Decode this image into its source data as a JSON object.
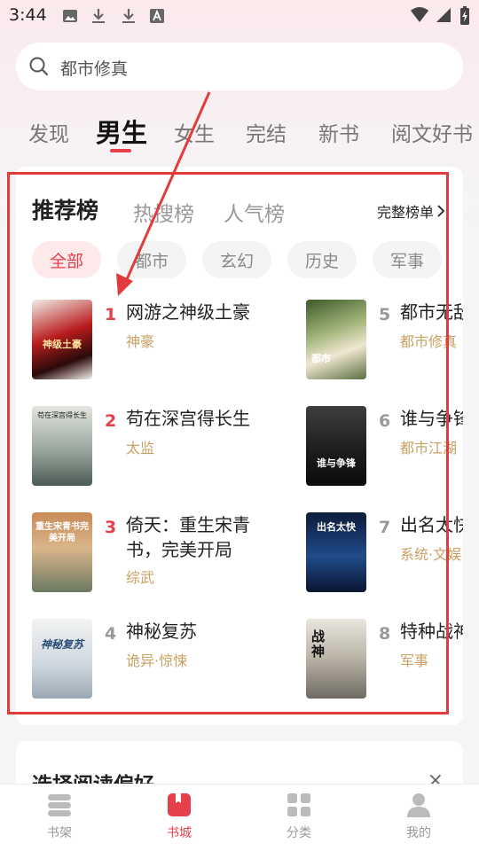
{
  "status_bar": {
    "time": "3:44"
  },
  "search": {
    "text": "都市修真"
  },
  "category_tabs": [
    {
      "label": "发现"
    },
    {
      "label": "男生"
    },
    {
      "label": "女生"
    },
    {
      "label": "完结"
    },
    {
      "label": "新书"
    },
    {
      "label": "阅文好书"
    }
  ],
  "ranking": {
    "tabs": [
      {
        "label": "推荐榜"
      },
      {
        "label": "热搜榜"
      },
      {
        "label": "人气榜"
      }
    ],
    "full_label": "完整榜单",
    "chips": [
      {
        "label": "全部"
      },
      {
        "label": "都市"
      },
      {
        "label": "玄幻"
      },
      {
        "label": "历史"
      },
      {
        "label": "军事"
      }
    ],
    "books": [
      {
        "rank": "1",
        "title": "网游之神级土豪",
        "tag": "神豪"
      },
      {
        "rank": "2",
        "title": "苟在深宫得长生",
        "tag": "太监"
      },
      {
        "rank": "3",
        "title": "倚天：重生宋青书，完美开局",
        "tag": "综武"
      },
      {
        "rank": "4",
        "title": "神秘复苏",
        "tag": "诡异·惊悚"
      },
      {
        "rank": "5",
        "title": "都市无敌",
        "tag": "都市修真"
      },
      {
        "rank": "6",
        "title": "谁与争锋",
        "tag": "都市江湖"
      },
      {
        "rank": "7",
        "title": "出名太快",
        "tag": "系统·文娱"
      },
      {
        "rank": "8",
        "title": "特种战神",
        "tag": "军事"
      }
    ],
    "covers": [
      {
        "text": "神级土豪"
      },
      {
        "text": "苟在深宫得长生"
      },
      {
        "text": "重生宋青书完美开局"
      },
      {
        "text": "神秘复苏"
      },
      {
        "text": "都市"
      },
      {
        "text": "谁与争锋"
      },
      {
        "text": "出名太快"
      },
      {
        "text": "战神"
      }
    ]
  },
  "preference": {
    "title": "选择阅读偏好",
    "close": "×"
  },
  "bottom_nav": [
    {
      "label": "书架"
    },
    {
      "label": "书城"
    },
    {
      "label": "分类"
    },
    {
      "label": "我的"
    }
  ],
  "colors": {
    "accent": "#e8404b",
    "tag": "#c9a063",
    "annotation": "#e23b3b"
  }
}
